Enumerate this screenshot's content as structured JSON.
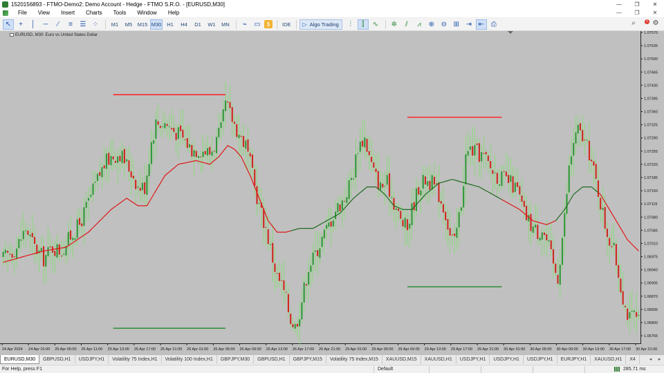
{
  "window": {
    "title": "1520156893 - FTMO-Demo2: Demo Account - Hedge - FTMO S.R.O. - [EURUSD,M30]",
    "controls": [
      "—",
      "❐",
      "✕"
    ]
  },
  "menu": {
    "items": [
      "File",
      "View",
      "Insert",
      "Charts",
      "Tools",
      "Window",
      "Help"
    ],
    "child_controls": [
      "—",
      "❐",
      "✕"
    ]
  },
  "toolbar": {
    "timeframes": [
      "M1",
      "M5",
      "M15",
      "M30",
      "H1",
      "H4",
      "D1",
      "W1",
      "MN"
    ],
    "active_timeframe": "M30",
    "ide_label": "IDE",
    "algo_label": "Algo Trading",
    "notification_count": "1"
  },
  "chart": {
    "caption": "EURUSD, M30:  Euro vs United States Dollar",
    "colors": {
      "background": "#c0c0c0",
      "bull": "#2f9a36",
      "bear": "#cc2b1d",
      "wick": "#7ee06b",
      "ma_up": "#1e6a1e",
      "ma_down": "#e01616",
      "level_red": "#ff1a1a",
      "level_green": "#1f8a2a"
    }
  },
  "chart_data": {
    "type": "candlestick",
    "symbol": "EURUSD",
    "timeframe": "M30",
    "ylim": [
      1.06745,
      1.0757
    ],
    "price_ticks": [
      "1.07570",
      "1.07535",
      "1.07500",
      "1.07465",
      "1.07430",
      "1.07395",
      "1.07360",
      "1.07325",
      "1.07290",
      "1.07255",
      "1.07220",
      "1.07185",
      "1.07150",
      "1.07115",
      "1.07080",
      "1.07045",
      "1.07010",
      "1.06975",
      "1.06940",
      "1.06905",
      "1.06870",
      "1.06835",
      "1.06800",
      "1.06765"
    ],
    "time_labels": [
      "24 Apr 2024",
      "24 Apr 01:00",
      "25 Apr 05:00",
      "25 Apr 11:00",
      "25 Apr 13:00",
      "25 Apr 17:00",
      "25 Apr 21:00",
      "26 Apr 01:00",
      "26 Apr 05:00",
      "26 Apr 09:00",
      "26 Apr 13:00",
      "26 Apr 17:00",
      "26 Apr 21:00",
      "29 Apr 01:00",
      "29 Apr 05:00",
      "29 Apr 09:00",
      "29 Apr 13:00",
      "29 Apr 17:00",
      "29 Apr 21:00",
      "30 Apr 01:00",
      "30 Apr 05:00",
      "30 Apr 09:00",
      "30 Apr 13:00",
      "30 Apr 17:00",
      "30 Apr 21:00"
    ],
    "candle_path": [
      [
        0,
        1.0697
      ],
      [
        6,
        1.07
      ],
      [
        10,
        1.0705
      ],
      [
        14,
        1.07
      ],
      [
        18,
        1.0697
      ],
      [
        22,
        1.07
      ],
      [
        26,
        1.0699
      ],
      [
        30,
        1.0703
      ],
      [
        34,
        1.0706
      ],
      [
        38,
        1.0712
      ],
      [
        42,
        1.0718
      ],
      [
        45,
        1.0722
      ],
      [
        48,
        1.0724
      ],
      [
        52,
        1.0725
      ],
      [
        55,
        1.0722
      ],
      [
        58,
        1.0719
      ],
      [
        60,
        1.0716
      ],
      [
        63,
        1.0716
      ],
      [
        66,
        1.0728
      ],
      [
        68,
        1.0733
      ],
      [
        72,
        1.0733
      ],
      [
        76,
        1.0731
      ],
      [
        80,
        1.0729
      ],
      [
        84,
        1.0726
      ],
      [
        88,
        1.0726
      ],
      [
        92,
        1.0725
      ],
      [
        94,
        1.0727
      ],
      [
        97,
        1.0731
      ],
      [
        99,
        1.0738
      ],
      [
        102,
        1.0734
      ],
      [
        105,
        1.073
      ],
      [
        108,
        1.0727
      ],
      [
        110,
        1.0722
      ],
      [
        112,
        1.0716
      ],
      [
        114,
        1.0711
      ],
      [
        117,
        1.0705
      ],
      [
        120,
        1.0697
      ],
      [
        122,
        1.0692
      ],
      [
        124,
        1.069
      ],
      [
        126,
        1.0686
      ],
      [
        128,
        1.0681
      ],
      [
        130,
        1.0679
      ],
      [
        132,
        1.0683
      ],
      [
        134,
        1.0689
      ],
      [
        136,
        1.0695
      ],
      [
        138,
        1.0697
      ],
      [
        141,
        1.0701
      ],
      [
        145,
        1.0706
      ],
      [
        148,
        1.071
      ],
      [
        152,
        1.0713
      ],
      [
        156,
        1.072
      ],
      [
        158,
        1.0727
      ],
      [
        161,
        1.0729
      ],
      [
        163,
        1.0724
      ],
      [
        165,
        1.072
      ],
      [
        168,
        1.0716
      ],
      [
        171,
        1.0717
      ],
      [
        174,
        1.0712
      ],
      [
        177,
        1.0707
      ],
      [
        180,
        1.0705
      ],
      [
        182,
        1.071
      ],
      [
        185,
        1.0716
      ],
      [
        188,
        1.0718
      ],
      [
        191,
        1.0717
      ],
      [
        194,
        1.0714
      ],
      [
        197,
        1.0709
      ],
      [
        199,
        1.0703
      ],
      [
        201,
        1.0701
      ],
      [
        204,
        1.0712
      ],
      [
        206,
        1.0724
      ],
      [
        208,
        1.0726
      ],
      [
        211,
        1.0725
      ],
      [
        214,
        1.0724
      ],
      [
        217,
        1.0721
      ],
      [
        220,
        1.0719
      ],
      [
        223,
        1.0718
      ],
      [
        226,
        1.0717
      ],
      [
        229,
        1.0715
      ],
      [
        232,
        1.0709
      ],
      [
        235,
        1.0706
      ],
      [
        238,
        1.0704
      ],
      [
        240,
        1.0705
      ],
      [
        243,
        1.07
      ],
      [
        245,
        1.0695
      ],
      [
        247,
        1.0692
      ],
      [
        250,
        1.0708
      ],
      [
        252,
        1.0721
      ],
      [
        254,
        1.0728
      ],
      [
        256,
        1.0731
      ],
      [
        258,
        1.0729
      ],
      [
        261,
        1.0725
      ],
      [
        263,
        1.072
      ],
      [
        266,
        1.0712
      ],
      [
        268,
        1.0706
      ],
      [
        270,
        1.0702
      ],
      [
        272,
        1.0699
      ],
      [
        275,
        1.069
      ],
      [
        277,
        1.0684
      ],
      [
        279,
        1.0681
      ],
      [
        281,
        1.0682
      ],
      [
        283,
        1.068
      ]
    ],
    "moving_average": [
      [
        0,
        1.0696
      ],
      [
        18,
        1.0699
      ],
      [
        28,
        1.07
      ],
      [
        38,
        1.0704
      ],
      [
        48,
        1.071
      ],
      [
        55,
        1.0713
      ],
      [
        60,
        1.0711
      ],
      [
        64,
        1.0711
      ],
      [
        68,
        1.0715
      ],
      [
        72,
        1.0719
      ],
      [
        78,
        1.0722
      ],
      [
        86,
        1.0723
      ],
      [
        92,
        1.0722
      ],
      [
        96,
        1.0724
      ],
      [
        100,
        1.0727
      ],
      [
        103,
        1.0726
      ],
      [
        106,
        1.0724
      ],
      [
        110,
        1.0719
      ],
      [
        114,
        1.0713
      ],
      [
        118,
        1.0707
      ],
      [
        122,
        1.0704
      ],
      [
        126,
        1.0704
      ],
      [
        132,
        1.0705
      ],
      [
        138,
        1.0705
      ],
      [
        144,
        1.0707
      ],
      [
        150,
        1.0709
      ],
      [
        156,
        1.0713
      ],
      [
        162,
        1.0716
      ],
      [
        166,
        1.0716
      ],
      [
        170,
        1.0714
      ],
      [
        174,
        1.0711
      ],
      [
        178,
        1.071
      ],
      [
        182,
        1.071
      ],
      [
        188,
        1.0714
      ],
      [
        194,
        1.0717
      ],
      [
        200,
        1.0718
      ],
      [
        206,
        1.0717
      ],
      [
        212,
        1.0716
      ],
      [
        218,
        1.0714
      ],
      [
        224,
        1.0712
      ],
      [
        230,
        1.071
      ],
      [
        236,
        1.0707
      ],
      [
        242,
        1.0706
      ],
      [
        246,
        1.0707
      ],
      [
        250,
        1.071
      ],
      [
        254,
        1.0714
      ],
      [
        258,
        1.0716
      ],
      [
        262,
        1.0716
      ],
      [
        266,
        1.0714
      ],
      [
        270,
        1.071
      ],
      [
        274,
        1.0706
      ],
      [
        278,
        1.0702
      ],
      [
        283,
        1.0699
      ]
    ],
    "ma_turns_red_after": [
      106,
      222,
      265
    ],
    "ma_turns_green_after": [
      128,
      246
    ],
    "levels": [
      {
        "kind": "resistance",
        "price": 1.07405,
        "from": 49,
        "to": 99
      },
      {
        "kind": "support",
        "price": 1.06785,
        "from": 49,
        "to": 99
      },
      {
        "kind": "resistance",
        "price": 1.07345,
        "from": 180,
        "to": 222
      },
      {
        "kind": "support",
        "price": 1.06895,
        "from": 180,
        "to": 222
      }
    ]
  },
  "tabs": [
    "EURUSD,M30",
    "GBPUSD,H1",
    "USDJPY,H1",
    "Volatility 75 Index,H1",
    "Volatility 100 Index,H1",
    "GBPJPY,M30",
    "GBPUSD,H1",
    "GBPJPY,M15",
    "Volatility 75 Index,M15",
    "XAUUSD,M15",
    "XAUUSD,H1",
    "USDJPY,H1",
    "USDJPY,H1",
    "USDJPY,H1",
    "EURJPY,H1",
    "XAUUSD,H1",
    "X4"
  ],
  "tab_nav": [
    "◂",
    "▸"
  ],
  "status": {
    "help": "For Help, press F1",
    "profile": "Default",
    "ping": "285.71 ms"
  }
}
